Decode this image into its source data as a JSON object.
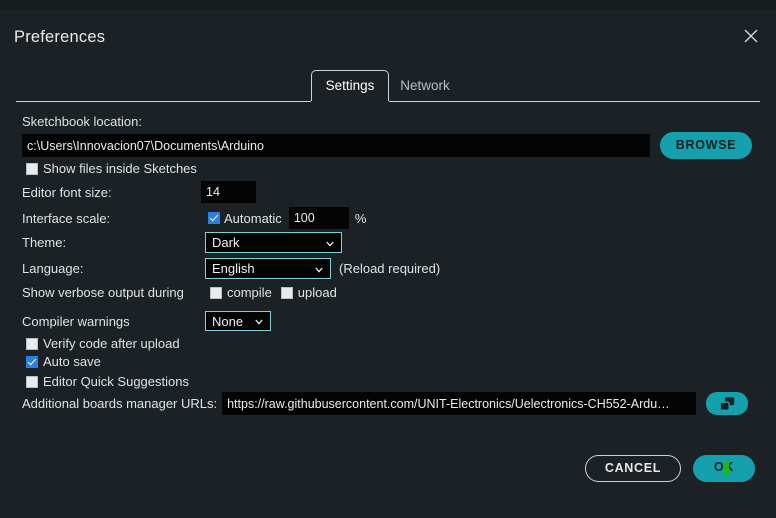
{
  "window": {
    "title": "Preferences",
    "close_icon": "close-icon"
  },
  "tabs": [
    {
      "label": "Settings",
      "active": true
    },
    {
      "label": "Network",
      "active": false
    }
  ],
  "settings": {
    "sketchbook": {
      "label": "Sketchbook location:",
      "value": "c:\\Users\\Innovacion07\\Documents\\Arduino",
      "browse_label": "BROWSE"
    },
    "show_files_inside_sketches": {
      "label": "Show files inside Sketches",
      "checked": false
    },
    "editor_font_size": {
      "label": "Editor font size:",
      "value": "14"
    },
    "interface_scale": {
      "label": "Interface scale:",
      "automatic_label": "Automatic",
      "automatic_checked": true,
      "value": "100",
      "unit": "%"
    },
    "theme": {
      "label": "Theme:",
      "value": "Dark",
      "options": [
        "Dark"
      ]
    },
    "language": {
      "label": "Language:",
      "value": "English",
      "options": [
        "English"
      ],
      "note": "(Reload required)"
    },
    "verbose_output": {
      "label": "Show verbose output during",
      "compile_label": "compile",
      "compile_checked": false,
      "upload_label": "upload",
      "upload_checked": false
    },
    "compiler_warnings": {
      "label": "Compiler warnings",
      "value": "None",
      "options": [
        "None"
      ]
    },
    "verify_code_after_upload": {
      "label": "Verify code after upload",
      "checked": false
    },
    "auto_save": {
      "label": "Auto save",
      "checked": true
    },
    "editor_quick_suggestions": {
      "label": "Editor Quick Suggestions",
      "checked": false
    },
    "additional_urls": {
      "label": "Additional boards manager URLs:",
      "value": "https://raw.githubusercontent.com/UNIT-Electronics/Uelectronics-CH552-Ardu…",
      "edit_icon": "open-window-icon"
    }
  },
  "footer": {
    "cancel_label": "CANCEL",
    "ok_label": "OK"
  },
  "colors": {
    "accent_teal": "#14a0ac",
    "checkbox_blue": "#2b7fe0",
    "dialog_bg": "#1b2124",
    "field_bg": "#040404",
    "cursor_green": "#18b81f"
  }
}
